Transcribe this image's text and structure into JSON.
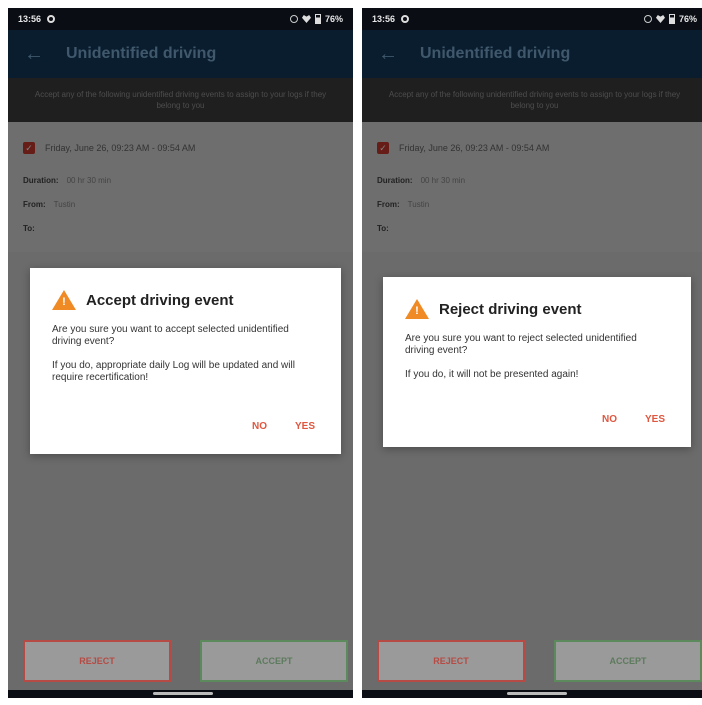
{
  "screens": [
    {
      "status": {
        "time": "13:56",
        "battery": "76%"
      },
      "appbar": {
        "title": "Unidentified driving"
      },
      "banner": "Accept any of the following unidentified driving events to assign to your logs if they belong to you",
      "event": {
        "label": "Friday, June 26, 09:23 AM - 09:54 AM",
        "duration_label": "Duration:",
        "duration_value": "00 hr 30 min",
        "from_label": "From:",
        "from_value": "Tustin",
        "to_label": "To:"
      },
      "dialog": {
        "title": "Accept driving event",
        "message": "Are you sure you want to accept selected unidentified driving event?",
        "note": "If you do, appropriate daily Log will be updated and will require recertification!",
        "no": "NO",
        "yes": "YES"
      },
      "buttons": {
        "reject": "REJECT",
        "accept": "ACCEPT"
      }
    },
    {
      "status": {
        "time": "13:56",
        "battery": "76%"
      },
      "appbar": {
        "title": "Unidentified driving"
      },
      "banner": "Accept any of the following unidentified driving events to assign to your logs if they belong to you",
      "event": {
        "label": "Friday, June 26, 09:23 AM - 09:54 AM",
        "duration_label": "Duration:",
        "duration_value": "00 hr 30 min",
        "from_label": "From:",
        "from_value": "Tustin",
        "to_label": "To:"
      },
      "dialog": {
        "title": "Reject driving event",
        "message": "Are you sure you want to reject selected unidentified driving event?",
        "note": "If you do, it will not be presented again!",
        "no": "NO",
        "yes": "YES"
      },
      "buttons": {
        "reject": "REJECT",
        "accept": "ACCEPT"
      }
    }
  ],
  "icons": {
    "back": "arrow-left",
    "warning": "warning-triangle",
    "checkbox": "checked-box"
  },
  "colors": {
    "appbar": "#143a5c",
    "accent_red": "#e0563e",
    "warning": "#f08a24",
    "reject_border": "#b54b44",
    "accept_border": "#5d8a5d"
  }
}
